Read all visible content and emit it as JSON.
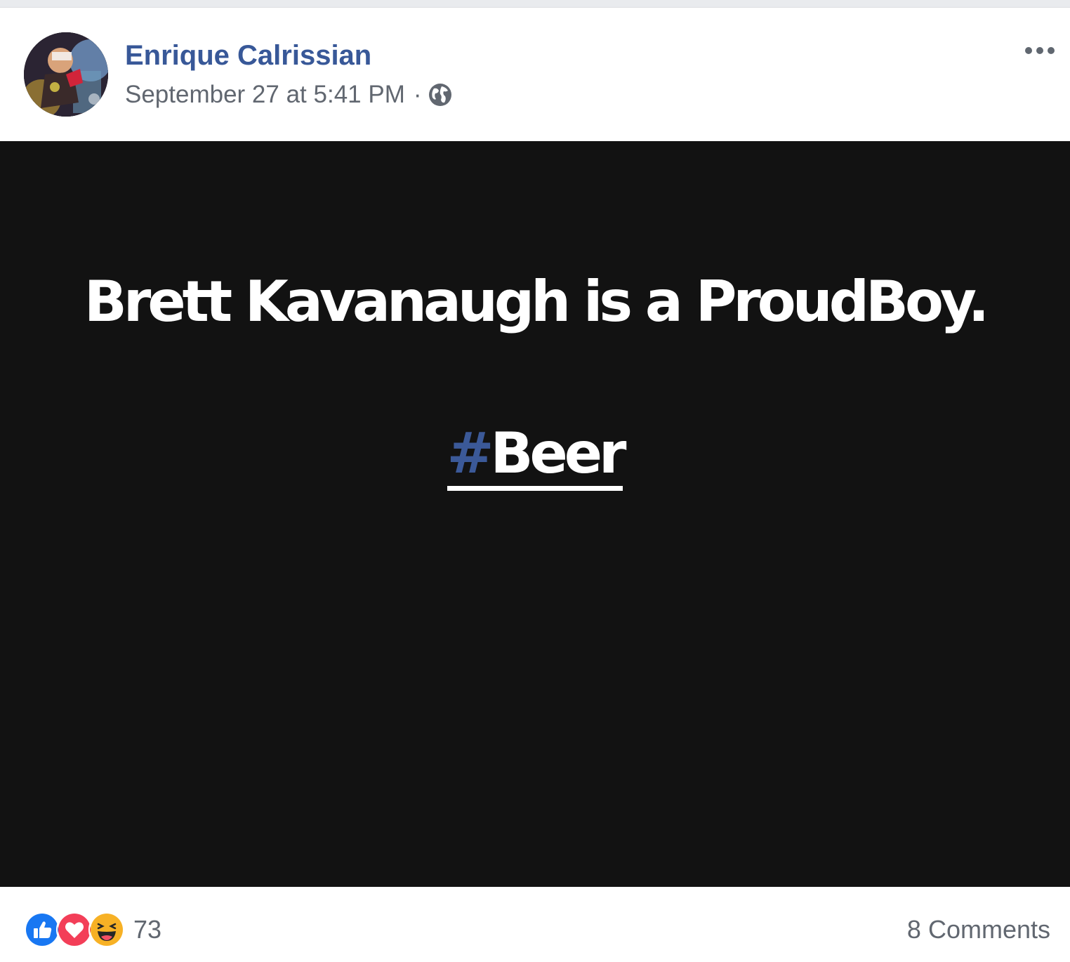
{
  "post": {
    "author": "Enrique Calrissian",
    "timestamp": "September 27 at 5:41 PM",
    "separator": "·",
    "privacy_icon": "globe-icon",
    "more_icon": "more-options-icon",
    "text_post": {
      "background_color": "#121212",
      "text_color": "#ffffff",
      "line1": "Brett Kavanaugh is a ProudBoy.",
      "hashtag_symbol": "#",
      "hashtag_word": "Beer",
      "hashtag_color": "#3b5998"
    },
    "footer": {
      "reactions": [
        "like-reaction-icon",
        "love-reaction-icon",
        "haha-reaction-icon"
      ],
      "reaction_count": "73",
      "comments_label": "8 Comments"
    }
  },
  "colors": {
    "author_link": "#385898",
    "meta_text": "#616770",
    "like_blue": "#1877f2",
    "love_red": "#f33e58",
    "haha_yellow": "#f7b125"
  }
}
